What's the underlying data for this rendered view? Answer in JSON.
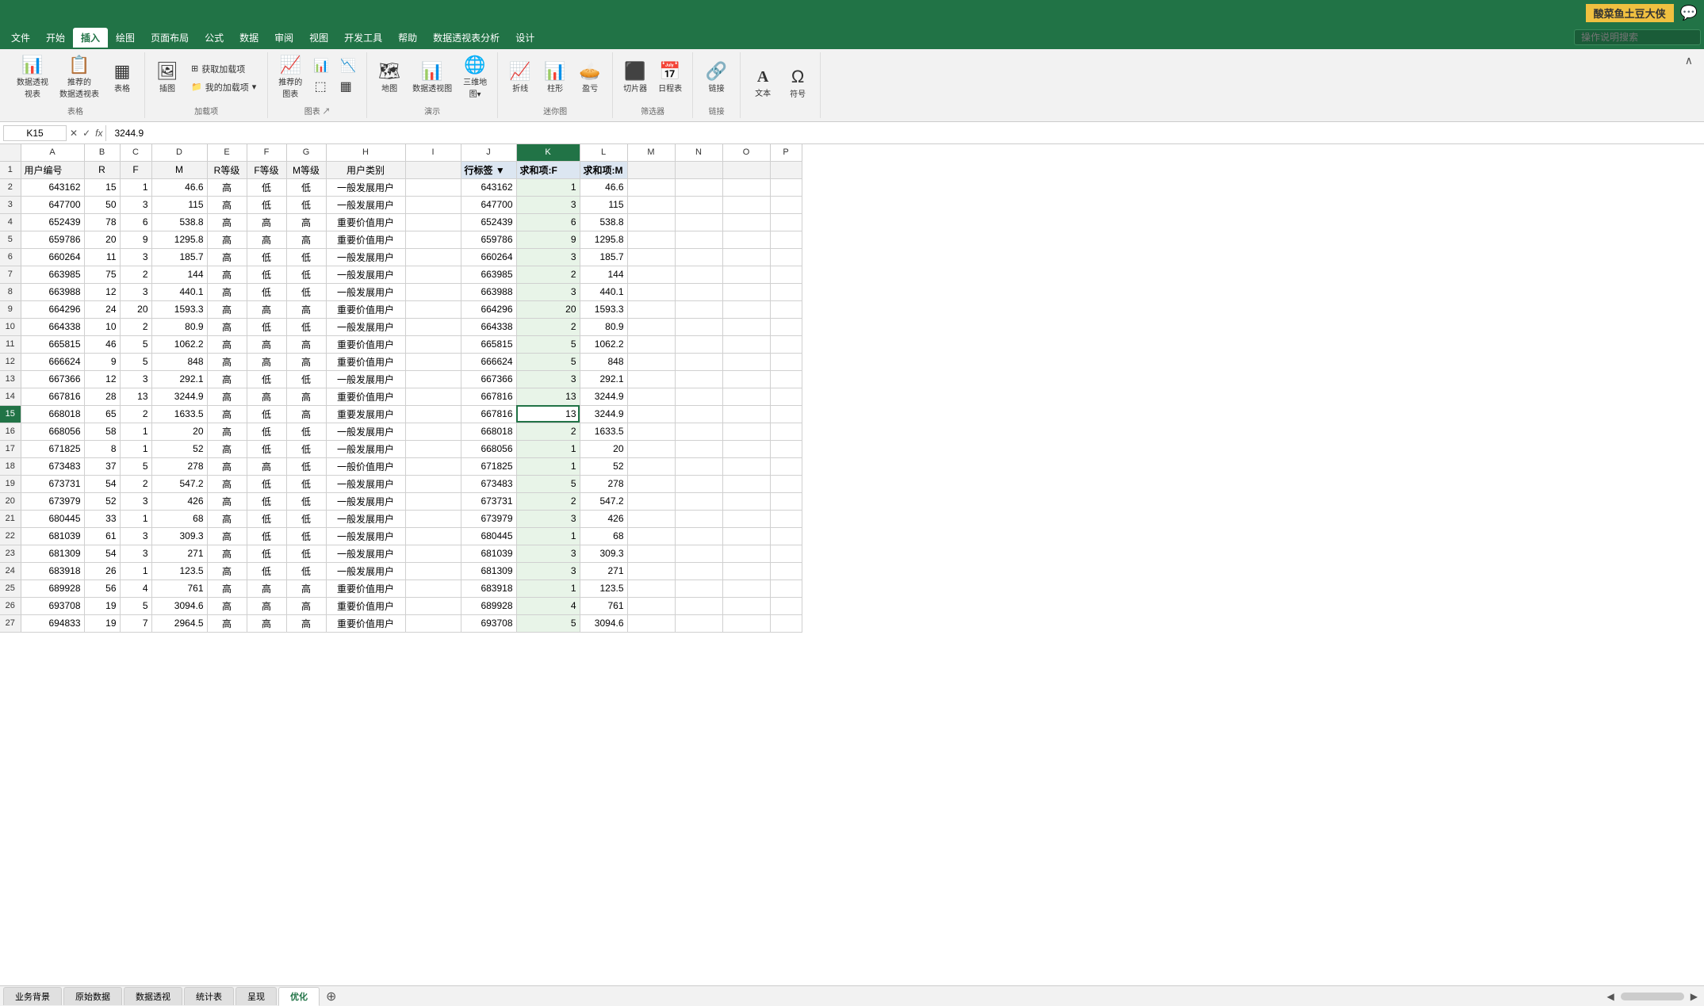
{
  "titleBar": {
    "appName": "酸菜鱼土豆大侠",
    "chatIcon": "💬"
  },
  "ribbonTabs": [
    {
      "label": "文件",
      "active": false
    },
    {
      "label": "开始",
      "active": false
    },
    {
      "label": "插入",
      "active": true
    },
    {
      "label": "绘图",
      "active": false
    },
    {
      "label": "页面布局",
      "active": false
    },
    {
      "label": "公式",
      "active": false
    },
    {
      "label": "数据",
      "active": false
    },
    {
      "label": "审阅",
      "active": false
    },
    {
      "label": "视图",
      "active": false
    },
    {
      "label": "开发工具",
      "active": false
    },
    {
      "label": "帮助",
      "active": false
    },
    {
      "label": "数据透视表分析",
      "active": false
    },
    {
      "label": "设计",
      "active": false
    }
  ],
  "searchPlaceholder": "操作说明搜索",
  "ribbonGroups": [
    {
      "label": "表格",
      "buttons": [
        {
          "icon": "📊",
          "label": "数据透视\n视表"
        },
        {
          "icon": "📋",
          "label": "推荐的\n数据透视表"
        },
        {
          "icon": "▦",
          "label": "表格"
        }
      ]
    },
    {
      "label": "加载项",
      "buttons": [
        {
          "icon": "📦",
          "label": "插图"
        },
        {
          "icon": "⊞",
          "label": "获取加载项"
        },
        {
          "icon": "📁",
          "label": "我的加载项"
        }
      ]
    },
    {
      "label": "图表",
      "buttons": [
        {
          "icon": "📈",
          "label": "推荐的\n图表"
        },
        {
          "icon": "📊",
          "label": ""
        },
        {
          "icon": "📉",
          "label": ""
        }
      ]
    },
    {
      "label": "演示",
      "buttons": [
        {
          "icon": "🗺",
          "label": "地图"
        },
        {
          "icon": "📊",
          "label": "数据透视图"
        },
        {
          "icon": "🌐",
          "label": "三维地\n图"
        }
      ]
    },
    {
      "label": "迷你图",
      "buttons": [
        {
          "icon": "📈",
          "label": "折线"
        },
        {
          "icon": "📊",
          "label": "柱形"
        },
        {
          "icon": "🥧",
          "label": "盈亏"
        }
      ]
    },
    {
      "label": "筛选器",
      "buttons": [
        {
          "icon": "⬛",
          "label": "切片器"
        },
        {
          "icon": "📅",
          "label": "日程表"
        }
      ]
    },
    {
      "label": "链接",
      "buttons": [
        {
          "icon": "🔗",
          "label": "链接"
        }
      ]
    },
    {
      "label": "",
      "buttons": [
        {
          "icon": "A",
          "label": "文本"
        },
        {
          "icon": "Ω",
          "label": "符号"
        }
      ]
    }
  ],
  "formulaBar": {
    "cellRef": "K15",
    "formula": "3244.9"
  },
  "columns": [
    {
      "label": "A",
      "width": "w-col-a"
    },
    {
      "label": "B",
      "width": "w-col-b"
    },
    {
      "label": "C",
      "width": "w-col-c"
    },
    {
      "label": "D",
      "width": "w-col-d"
    },
    {
      "label": "E",
      "width": "w-col-e"
    },
    {
      "label": "F",
      "width": "w-col-f"
    },
    {
      "label": "G",
      "width": "w-col-g"
    },
    {
      "label": "H",
      "width": "w-col-h"
    },
    {
      "label": "I",
      "width": "w-col-i"
    },
    {
      "label": "J",
      "width": "w-col-j"
    },
    {
      "label": "K",
      "width": "w-col-k",
      "selected": true
    },
    {
      "label": "L",
      "width": "w-col-l"
    },
    {
      "label": "M",
      "width": "w-col-m"
    },
    {
      "label": "N",
      "width": "w-col-n"
    },
    {
      "label": "O",
      "width": "w-col-o"
    },
    {
      "label": "P",
      "width": "w-col-p"
    }
  ],
  "rows": [
    {
      "num": 1,
      "cells": [
        "用户编号",
        "R",
        "F",
        "M",
        "R等级",
        "F等级",
        "M等级",
        "用户类别",
        "",
        "行标签 ▼",
        "求和项:F",
        "求和项:M",
        "",
        "",
        "",
        ""
      ]
    },
    {
      "num": 2,
      "cells": [
        "643162",
        "15",
        "1",
        "46.6",
        "高",
        "低",
        "低",
        "一般发展用户",
        "",
        "643162",
        "1",
        "46.6",
        "",
        "",
        "",
        ""
      ]
    },
    {
      "num": 3,
      "cells": [
        "647700",
        "50",
        "3",
        "115",
        "高",
        "低",
        "低",
        "一般发展用户",
        "",
        "647700",
        "3",
        "115",
        "",
        "",
        "",
        ""
      ]
    },
    {
      "num": 4,
      "cells": [
        "652439",
        "78",
        "6",
        "538.8",
        "高",
        "高",
        "高",
        "重要价值用户",
        "",
        "652439",
        "6",
        "538.8",
        "",
        "",
        "",
        ""
      ]
    },
    {
      "num": 5,
      "cells": [
        "659786",
        "20",
        "9",
        "1295.8",
        "高",
        "高",
        "高",
        "重要价值用户",
        "",
        "659786",
        "9",
        "1295.8",
        "",
        "",
        "",
        ""
      ]
    },
    {
      "num": 6,
      "cells": [
        "660264",
        "11",
        "3",
        "185.7",
        "高",
        "低",
        "低",
        "一般发展用户",
        "",
        "660264",
        "3",
        "185.7",
        "",
        "",
        "",
        ""
      ]
    },
    {
      "num": 7,
      "cells": [
        "663985",
        "75",
        "2",
        "144",
        "高",
        "低",
        "低",
        "一般发展用户",
        "",
        "663985",
        "2",
        "144",
        "",
        "",
        "",
        ""
      ]
    },
    {
      "num": 8,
      "cells": [
        "663988",
        "12",
        "3",
        "440.1",
        "高",
        "低",
        "低",
        "一般发展用户",
        "",
        "663988",
        "3",
        "440.1",
        "",
        "",
        "",
        ""
      ]
    },
    {
      "num": 9,
      "cells": [
        "664296",
        "24",
        "20",
        "1593.3",
        "高",
        "高",
        "高",
        "重要价值用户",
        "",
        "664296",
        "20",
        "1593.3",
        "",
        "",
        "",
        ""
      ]
    },
    {
      "num": 10,
      "cells": [
        "664338",
        "10",
        "2",
        "80.9",
        "高",
        "低",
        "低",
        "一般发展用户",
        "",
        "664338",
        "2",
        "80.9",
        "",
        "",
        "",
        ""
      ]
    },
    {
      "num": 11,
      "cells": [
        "665815",
        "46",
        "5",
        "1062.2",
        "高",
        "高",
        "高",
        "重要价值用户",
        "",
        "665815",
        "5",
        "1062.2",
        "",
        "",
        "",
        ""
      ]
    },
    {
      "num": 12,
      "cells": [
        "666624",
        "9",
        "5",
        "848",
        "高",
        "高",
        "高",
        "重要价值用户",
        "",
        "666624",
        "5",
        "848",
        "",
        "",
        "",
        ""
      ]
    },
    {
      "num": 13,
      "cells": [
        "667366",
        "12",
        "3",
        "292.1",
        "高",
        "低",
        "低",
        "一般发展用户",
        "",
        "667366",
        "3",
        "292.1",
        "",
        "",
        "",
        ""
      ]
    },
    {
      "num": 14,
      "cells": [
        "667816",
        "28",
        "13",
        "3244.9",
        "高",
        "高",
        "高",
        "重要价值用户",
        "",
        "667816",
        "13",
        "3244.9",
        "",
        "",
        "",
        ""
      ]
    },
    {
      "num": 15,
      "cells": [
        "668018",
        "65",
        "2",
        "1633.5",
        "高",
        "低",
        "高",
        "重要发展用户",
        "",
        "667816",
        "13",
        "3244.9",
        "",
        "",
        "",
        ""
      ],
      "activeK": true
    },
    {
      "num": 16,
      "cells": [
        "668056",
        "58",
        "1",
        "20",
        "高",
        "低",
        "低",
        "一般发展用户",
        "",
        "668018",
        "2",
        "1633.5",
        "",
        "",
        "",
        ""
      ]
    },
    {
      "num": 17,
      "cells": [
        "671825",
        "8",
        "1",
        "52",
        "高",
        "低",
        "低",
        "一般发展用户",
        "",
        "668056",
        "1",
        "20",
        "",
        "",
        "",
        ""
      ]
    },
    {
      "num": 18,
      "cells": [
        "673483",
        "37",
        "5",
        "278",
        "高",
        "高",
        "低",
        "一般价值用户",
        "",
        "671825",
        "1",
        "52",
        "",
        "",
        "",
        ""
      ]
    },
    {
      "num": 19,
      "cells": [
        "673731",
        "54",
        "2",
        "547.2",
        "高",
        "低",
        "低",
        "一般发展用户",
        "",
        "673483",
        "5",
        "278",
        "",
        "",
        "",
        ""
      ]
    },
    {
      "num": 20,
      "cells": [
        "673979",
        "52",
        "3",
        "426",
        "高",
        "低",
        "低",
        "一般发展用户",
        "",
        "673731",
        "2",
        "547.2",
        "",
        "",
        "",
        ""
      ]
    },
    {
      "num": 21,
      "cells": [
        "680445",
        "33",
        "1",
        "68",
        "高",
        "低",
        "低",
        "一般发展用户",
        "",
        "673979",
        "3",
        "426",
        "",
        "",
        "",
        ""
      ]
    },
    {
      "num": 22,
      "cells": [
        "681039",
        "61",
        "3",
        "309.3",
        "高",
        "低",
        "低",
        "一般发展用户",
        "",
        "680445",
        "1",
        "68",
        "",
        "",
        "",
        ""
      ]
    },
    {
      "num": 23,
      "cells": [
        "681309",
        "54",
        "3",
        "271",
        "高",
        "低",
        "低",
        "一般发展用户",
        "",
        "681039",
        "3",
        "309.3",
        "",
        "",
        "",
        ""
      ]
    },
    {
      "num": 24,
      "cells": [
        "683918",
        "26",
        "1",
        "123.5",
        "高",
        "低",
        "低",
        "一般发展用户",
        "",
        "681309",
        "3",
        "271",
        "",
        "",
        "",
        ""
      ]
    },
    {
      "num": 25,
      "cells": [
        "689928",
        "56",
        "4",
        "761",
        "高",
        "高",
        "高",
        "重要价值用户",
        "",
        "683918",
        "1",
        "123.5",
        "",
        "",
        "",
        ""
      ]
    },
    {
      "num": 26,
      "cells": [
        "693708",
        "19",
        "5",
        "3094.6",
        "高",
        "高",
        "高",
        "重要价值用户",
        "",
        "689928",
        "4",
        "761",
        "",
        "",
        "",
        ""
      ]
    },
    {
      "num": 27,
      "cells": [
        "694833",
        "19",
        "7",
        "2964.5",
        "高",
        "高",
        "高",
        "重要价值用户",
        "",
        "693708",
        "5",
        "3094.6",
        "",
        "",
        "",
        ""
      ]
    }
  ],
  "sheets": [
    {
      "label": "业务背景",
      "active": false
    },
    {
      "label": "原始数据",
      "active": false
    },
    {
      "label": "数据透视",
      "active": false
    },
    {
      "label": "统计表",
      "active": false
    },
    {
      "label": "呈现",
      "active": false
    },
    {
      "label": "优化",
      "active": true
    }
  ]
}
